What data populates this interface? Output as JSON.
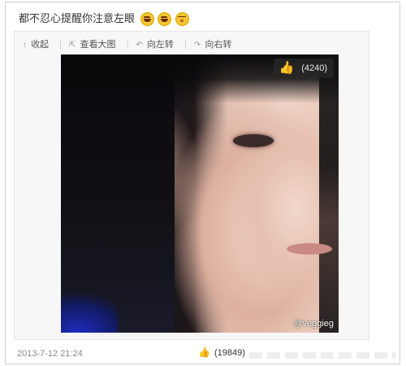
{
  "post": {
    "text": "都不忍心提醒你注意左眼",
    "emojis": [
      "laugh-emoji",
      "laugh-emoji",
      "shy-emoji"
    ]
  },
  "toolbar": {
    "collapse": "收起",
    "view_large": "查看大图",
    "rotate_left": "向左转",
    "rotate_right": "向右转"
  },
  "image": {
    "like_count": "(4240)",
    "watermark": "@veggieg"
  },
  "footer": {
    "timestamp": "2013-7-12 21:24",
    "like_count": "(19849)"
  },
  "icons": {
    "collapse": "collapse-icon",
    "view_large": "view-large-icon",
    "rotate_left": "rotate-left-icon",
    "rotate_right": "rotate-right-icon",
    "like": "thumbs-up-icon"
  },
  "colors": {
    "like_blue": "#5a8ad5",
    "badge_bg": "#282828"
  }
}
